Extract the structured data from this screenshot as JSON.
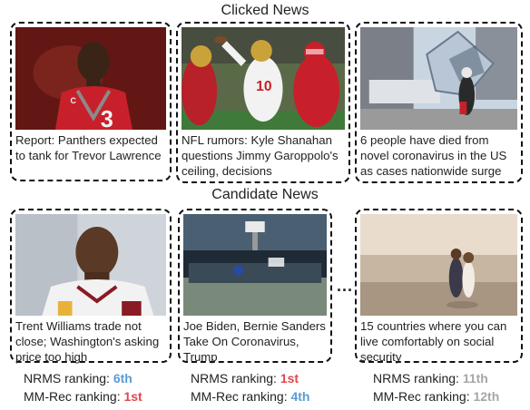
{
  "clicked_title": "Clicked News",
  "candidate_title": "Candidate News",
  "clicked_news": [
    {
      "caption": "Report: Panthers expected to tank for Trevor Lawrence",
      "image": "football-player-red-jersey-photo"
    },
    {
      "caption": "NFL rumors: Kyle Shanahan questions Jimmy Garoppolo's ceiling, decisions",
      "image": "quarterback-throwing-photo"
    },
    {
      "caption": "6 people have died from novel coronavirus in the US as cases nationwide surge",
      "image": "city-street-masked-pedestrian-photo"
    }
  ],
  "candidate_news": [
    {
      "caption": "Trent Williams trade not close; Washington's asking price too high",
      "image": "football-player-helmetless-photo",
      "nrms_label": "NRMS ranking:",
      "nrms_rank": "6th",
      "nrms_color": "#5b9bd5",
      "mmrec_label": "MM-Rec ranking:",
      "mmrec_rank": "1st",
      "mmrec_color": "#e0474c"
    },
    {
      "caption": "Joe Biden, Bernie Sanders Take On Coronavirus, Trump",
      "image": "empty-debate-stage-photo",
      "nrms_label": "NRMS ranking:",
      "nrms_rank": "1st",
      "nrms_color": "#e0474c",
      "mmrec_label": "MM-Rec ranking:",
      "mmrec_rank": "4th",
      "mmrec_color": "#5b9bd5"
    },
    {
      "caption": "15 countries where you can live comfortably on social security",
      "image": "couple-on-beach-photo",
      "nrms_label": "NRMS ranking:",
      "nrms_rank": "11th",
      "nrms_color": "#a6a6a6",
      "mmrec_label": "MM-Rec ranking:",
      "mmrec_rank": "12th",
      "mmrec_color": "#a6a6a6"
    }
  ],
  "ellipsis": "..."
}
